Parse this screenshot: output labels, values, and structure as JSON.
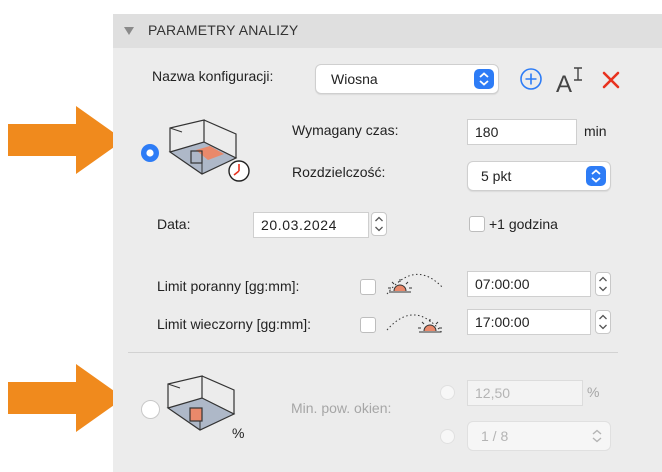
{
  "panel": {
    "title": "PARAMETRY ANALIZY",
    "collapse_icon": "triangle-down-icon"
  },
  "config": {
    "label": "Nazwa konfiguracji:",
    "value": "Wiosna",
    "add_icon": "plus-circle-icon",
    "rename_icon": "rename-text-icon",
    "delete_icon": "close-x-icon",
    "accent_blue": "#2d7cf6",
    "delete_color": "#e8321f"
  },
  "time_mode": {
    "selected": true,
    "room_icon": "room-sunlight-clock-icon",
    "required_time_label": "Wymagany czas:",
    "required_time_value": "180",
    "required_time_unit": "min",
    "resolution_label": "Rozdzielczość:",
    "resolution_value": "5 pkt",
    "date_label": "Data:",
    "date_value": "20.03.2024",
    "extra_hour_label": "+1 godzina",
    "extra_hour_checked": false,
    "morning_label": "Limit poranny [gg:mm]:",
    "morning_checked": false,
    "morning_icon": "sunrise-icon",
    "morning_value": "07:00:00",
    "evening_label": "Limit wieczorny [gg:mm]:",
    "evening_checked": false,
    "evening_icon": "sunset-icon",
    "evening_value": "17:00:00"
  },
  "window_mode": {
    "selected": false,
    "room_icon": "room-window-percent-icon",
    "min_area_label": "Min. pow. okien:",
    "percent_value": "12,50",
    "percent_unit": "%",
    "ratio_value": "1 / 8"
  },
  "annotations": {
    "arrow_color": "#f08a1d",
    "arrow_icon": "arrow-right-icon"
  }
}
